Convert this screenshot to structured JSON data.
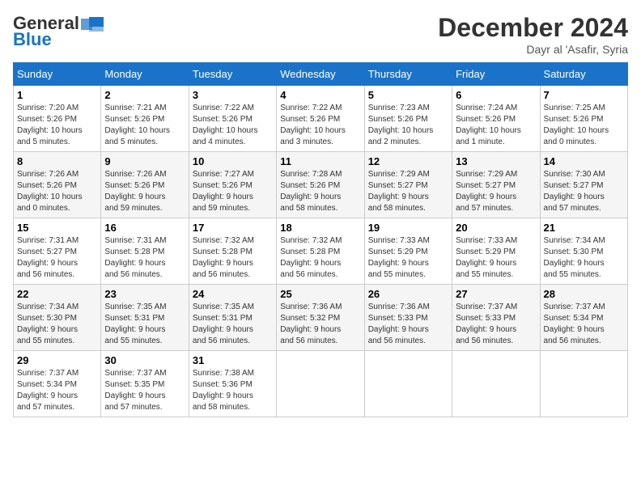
{
  "header": {
    "logo_general": "General",
    "logo_blue": "Blue",
    "month_title": "December 2024",
    "location": "Dayr al 'Asafir, Syria"
  },
  "days_of_week": [
    "Sunday",
    "Monday",
    "Tuesday",
    "Wednesday",
    "Thursday",
    "Friday",
    "Saturday"
  ],
  "weeks": [
    [
      {
        "day": 1,
        "info": "Sunrise: 7:20 AM\nSunset: 5:26 PM\nDaylight: 10 hours\nand 5 minutes."
      },
      {
        "day": 2,
        "info": "Sunrise: 7:21 AM\nSunset: 5:26 PM\nDaylight: 10 hours\nand 5 minutes."
      },
      {
        "day": 3,
        "info": "Sunrise: 7:22 AM\nSunset: 5:26 PM\nDaylight: 10 hours\nand 4 minutes."
      },
      {
        "day": 4,
        "info": "Sunrise: 7:22 AM\nSunset: 5:26 PM\nDaylight: 10 hours\nand 3 minutes."
      },
      {
        "day": 5,
        "info": "Sunrise: 7:23 AM\nSunset: 5:26 PM\nDaylight: 10 hours\nand 2 minutes."
      },
      {
        "day": 6,
        "info": "Sunrise: 7:24 AM\nSunset: 5:26 PM\nDaylight: 10 hours\nand 1 minute."
      },
      {
        "day": 7,
        "info": "Sunrise: 7:25 AM\nSunset: 5:26 PM\nDaylight: 10 hours\nand 0 minutes."
      }
    ],
    [
      {
        "day": 8,
        "info": "Sunrise: 7:26 AM\nSunset: 5:26 PM\nDaylight: 10 hours\nand 0 minutes."
      },
      {
        "day": 9,
        "info": "Sunrise: 7:26 AM\nSunset: 5:26 PM\nDaylight: 9 hours\nand 59 minutes."
      },
      {
        "day": 10,
        "info": "Sunrise: 7:27 AM\nSunset: 5:26 PM\nDaylight: 9 hours\nand 59 minutes."
      },
      {
        "day": 11,
        "info": "Sunrise: 7:28 AM\nSunset: 5:26 PM\nDaylight: 9 hours\nand 58 minutes."
      },
      {
        "day": 12,
        "info": "Sunrise: 7:29 AM\nSunset: 5:27 PM\nDaylight: 9 hours\nand 58 minutes."
      },
      {
        "day": 13,
        "info": "Sunrise: 7:29 AM\nSunset: 5:27 PM\nDaylight: 9 hours\nand 57 minutes."
      },
      {
        "day": 14,
        "info": "Sunrise: 7:30 AM\nSunset: 5:27 PM\nDaylight: 9 hours\nand 57 minutes."
      }
    ],
    [
      {
        "day": 15,
        "info": "Sunrise: 7:31 AM\nSunset: 5:27 PM\nDaylight: 9 hours\nand 56 minutes."
      },
      {
        "day": 16,
        "info": "Sunrise: 7:31 AM\nSunset: 5:28 PM\nDaylight: 9 hours\nand 56 minutes."
      },
      {
        "day": 17,
        "info": "Sunrise: 7:32 AM\nSunset: 5:28 PM\nDaylight: 9 hours\nand 56 minutes."
      },
      {
        "day": 18,
        "info": "Sunrise: 7:32 AM\nSunset: 5:28 PM\nDaylight: 9 hours\nand 56 minutes."
      },
      {
        "day": 19,
        "info": "Sunrise: 7:33 AM\nSunset: 5:29 PM\nDaylight: 9 hours\nand 55 minutes."
      },
      {
        "day": 20,
        "info": "Sunrise: 7:33 AM\nSunset: 5:29 PM\nDaylight: 9 hours\nand 55 minutes."
      },
      {
        "day": 21,
        "info": "Sunrise: 7:34 AM\nSunset: 5:30 PM\nDaylight: 9 hours\nand 55 minutes."
      }
    ],
    [
      {
        "day": 22,
        "info": "Sunrise: 7:34 AM\nSunset: 5:30 PM\nDaylight: 9 hours\nand 55 minutes."
      },
      {
        "day": 23,
        "info": "Sunrise: 7:35 AM\nSunset: 5:31 PM\nDaylight: 9 hours\nand 55 minutes."
      },
      {
        "day": 24,
        "info": "Sunrise: 7:35 AM\nSunset: 5:31 PM\nDaylight: 9 hours\nand 56 minutes."
      },
      {
        "day": 25,
        "info": "Sunrise: 7:36 AM\nSunset: 5:32 PM\nDaylight: 9 hours\nand 56 minutes."
      },
      {
        "day": 26,
        "info": "Sunrise: 7:36 AM\nSunset: 5:33 PM\nDaylight: 9 hours\nand 56 minutes."
      },
      {
        "day": 27,
        "info": "Sunrise: 7:37 AM\nSunset: 5:33 PM\nDaylight: 9 hours\nand 56 minutes."
      },
      {
        "day": 28,
        "info": "Sunrise: 7:37 AM\nSunset: 5:34 PM\nDaylight: 9 hours\nand 56 minutes."
      }
    ],
    [
      {
        "day": 29,
        "info": "Sunrise: 7:37 AM\nSunset: 5:34 PM\nDaylight: 9 hours\nand 57 minutes."
      },
      {
        "day": 30,
        "info": "Sunrise: 7:37 AM\nSunset: 5:35 PM\nDaylight: 9 hours\nand 57 minutes."
      },
      {
        "day": 31,
        "info": "Sunrise: 7:38 AM\nSunset: 5:36 PM\nDaylight: 9 hours\nand 58 minutes."
      },
      null,
      null,
      null,
      null
    ]
  ]
}
